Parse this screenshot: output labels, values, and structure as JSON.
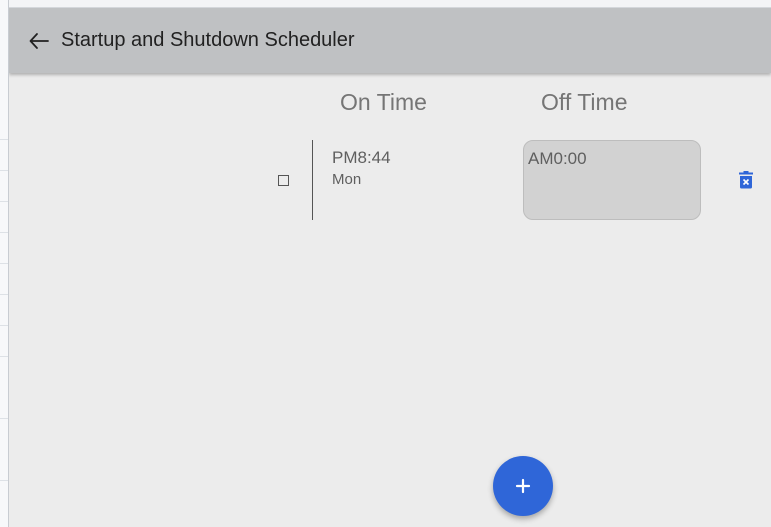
{
  "app": {
    "title": "Startup and Shutdown Scheduler",
    "back_icon": "arrow-left-icon"
  },
  "columns": {
    "on_time_label": "On Time",
    "off_time_label": "Off Time"
  },
  "schedules": [
    {
      "checked": false,
      "on_time": "PM8:44",
      "on_day": "Mon",
      "off_time": "AM0:00",
      "delete_icon": "delete-forever-icon"
    }
  ],
  "fab": {
    "label": "+",
    "icon": "plus-icon",
    "color": "#2f66d8"
  },
  "colors": {
    "appbar": "#bfc1c3",
    "background": "#ececec",
    "off_time_box": "#d2d2d2",
    "delete_icon": "#2f66d8"
  }
}
